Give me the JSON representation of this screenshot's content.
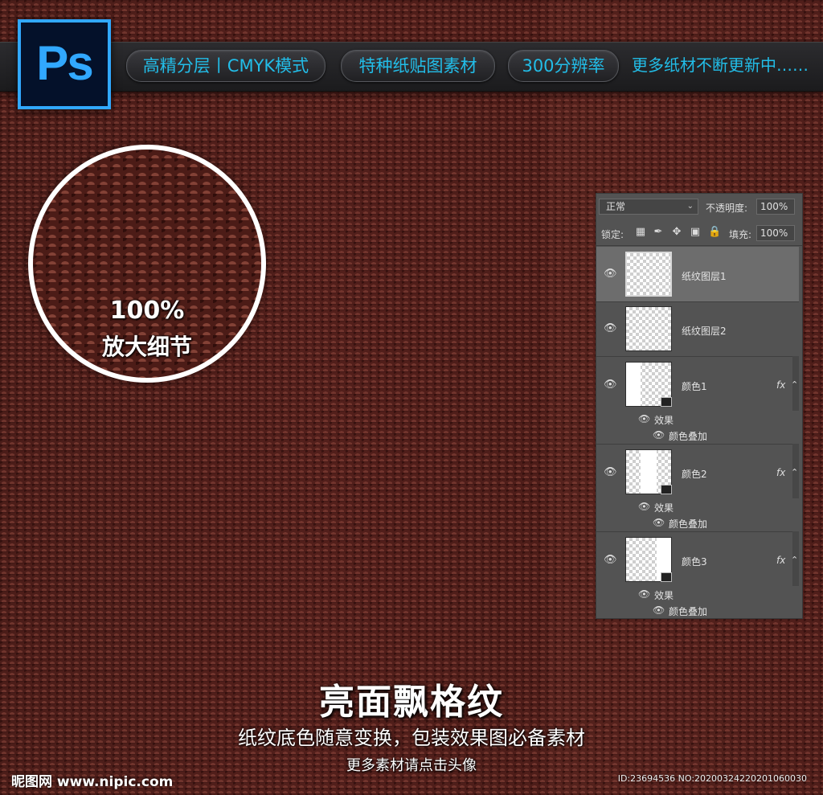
{
  "logo": {
    "text": "Ps",
    "color": "#31a8ff"
  },
  "banner": {
    "pills": [
      "高精分层丨CMYK模式",
      "特种纸贴图素材",
      "300分辨率"
    ],
    "tagline": "更多纸材不断更新中……",
    "text_color": "#22bde8"
  },
  "magnifier": {
    "percent": "100%",
    "label": "放大细节"
  },
  "layers_panel": {
    "blend_mode": "正常",
    "opacity_label": "不透明度:",
    "opacity_value": "100%",
    "lock_label": "锁定:",
    "fill_label": "填充:",
    "fill_value": "100%",
    "lock_icons": [
      "lock-transparent-icon",
      "lock-paint-icon",
      "lock-move-icon",
      "lock-artboard-icon",
      "lock-all-icon"
    ],
    "layers": [
      {
        "name": "纸纹图层1",
        "selected": true
      },
      {
        "name": "纸纹图层2",
        "selected": false
      },
      {
        "name": "颜色1",
        "fx": "fx",
        "effects_label": "效果",
        "effect": "颜色叠加"
      },
      {
        "name": "颜色2",
        "fx": "fx",
        "effects_label": "效果",
        "effect": "颜色叠加"
      },
      {
        "name": "颜色3",
        "fx": "fx",
        "effects_label": "效果",
        "effect": "颜色叠加"
      }
    ]
  },
  "footer": {
    "title": "亮面飘格纹",
    "subtitle": "纸纹底色随意变换，包装效果图必备素材",
    "note": "更多素材请点击头像",
    "watermark": "昵图网 www.nipic.com",
    "id_text": "ID:23694536 NO:20200324220201060030"
  }
}
